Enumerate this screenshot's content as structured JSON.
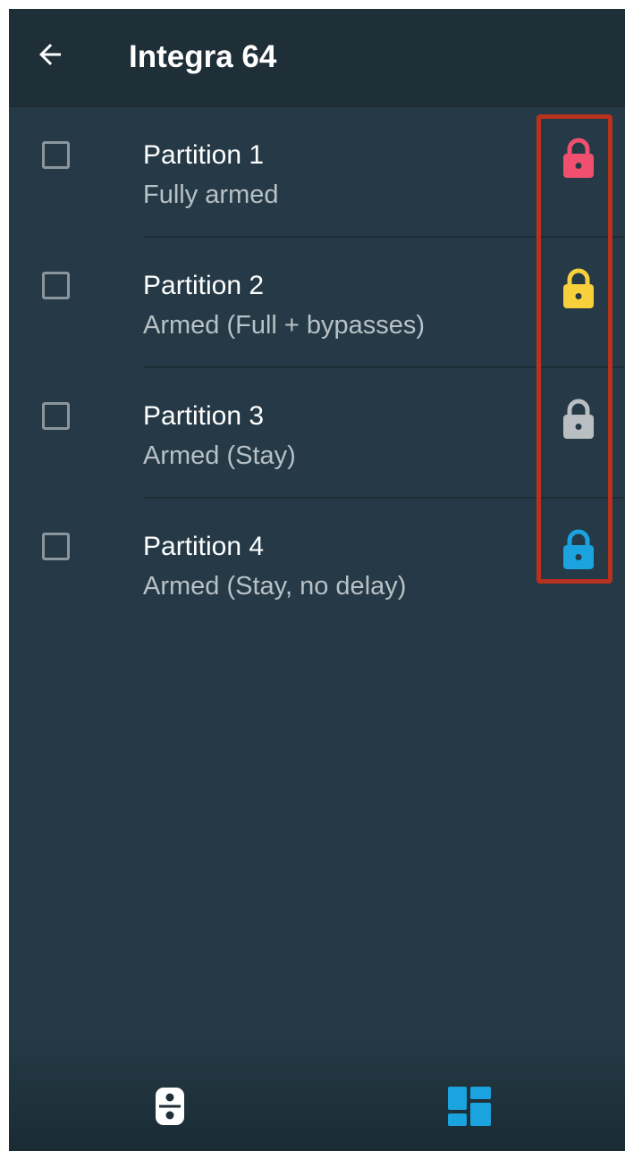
{
  "header": {
    "title": "Integra 64",
    "back_icon": "arrow-left-icon"
  },
  "partitions": [
    {
      "name": "Partition 1",
      "status": "Fully armed",
      "checked": false,
      "lock_icon": "lock-icon",
      "lock_color": "#f0506e"
    },
    {
      "name": "Partition 2",
      "status": "Armed (Full + bypasses)",
      "checked": false,
      "lock_icon": "lock-icon",
      "lock_color": "#f7d03c"
    },
    {
      "name": "Partition 3",
      "status": "Armed (Stay)",
      "checked": false,
      "lock_icon": "lock-icon",
      "lock_color": "#b9bec2"
    },
    {
      "name": "Partition 4",
      "status": "Armed (Stay, no delay)",
      "checked": false,
      "lock_icon": "lock-icon",
      "lock_color": "#1aa3df"
    }
  ],
  "bottom_nav": {
    "items": [
      {
        "icon": "keypad-icon",
        "active": false
      },
      {
        "icon": "dashboard-grid-icon",
        "active": true
      }
    ]
  },
  "colors": {
    "background": "#253a46",
    "appbar": "#1e2f38",
    "highlight_border": "#b8321f",
    "accent": "#1aa3df"
  }
}
